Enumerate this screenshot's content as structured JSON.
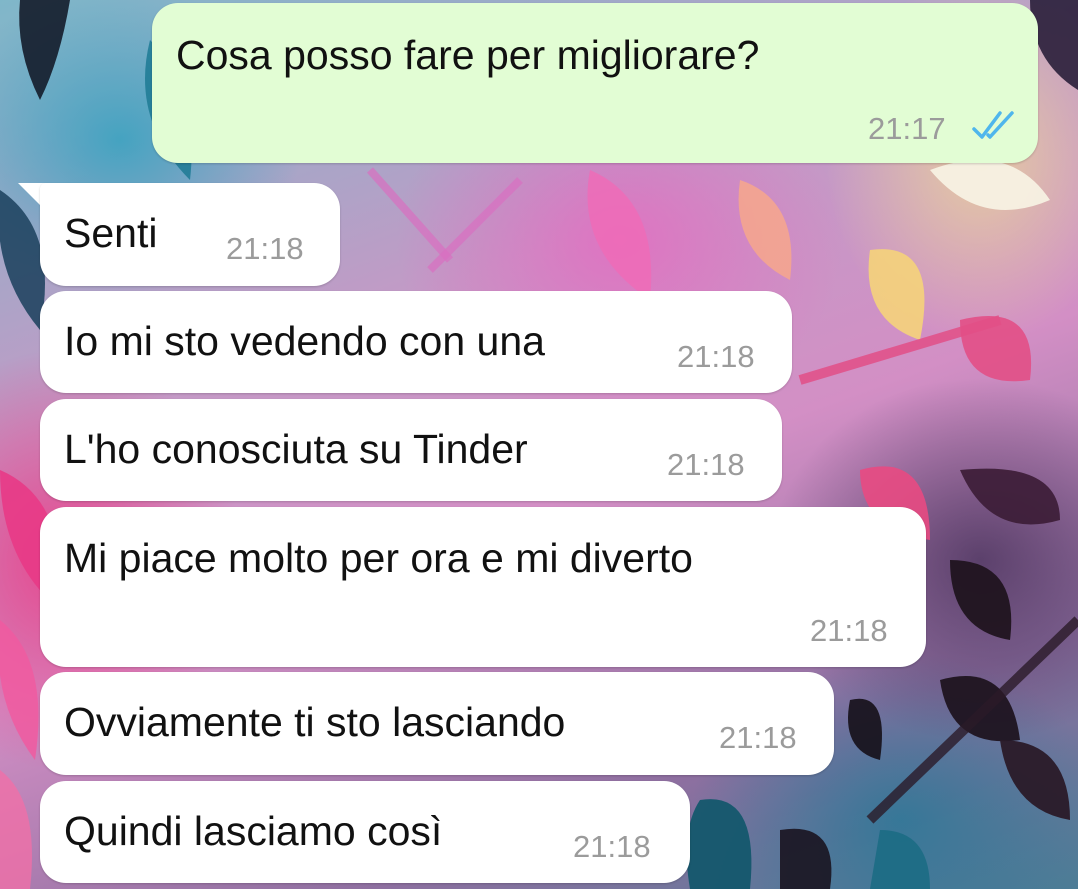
{
  "chat": {
    "messages": [
      {
        "direction": "outgoing",
        "text": "Cosa posso fare per migliorare?",
        "time": "21:17",
        "status": "read",
        "status_icon": "double-check-icon"
      },
      {
        "direction": "incoming",
        "text": "Senti",
        "time": "21:18"
      },
      {
        "direction": "incoming",
        "text": "Io mi sto vedendo con una",
        "time": "21:18"
      },
      {
        "direction": "incoming",
        "text": "L'ho conosciuta su Tinder",
        "time": "21:18"
      },
      {
        "direction": "incoming",
        "text": "Mi piace molto per ora e mi diverto",
        "time": "21:18"
      },
      {
        "direction": "incoming",
        "text": "Ovviamente ti sto lasciando",
        "time": "21:18"
      },
      {
        "direction": "incoming",
        "text": "Quindi lasciamo così",
        "time": "21:18"
      }
    ]
  },
  "colors": {
    "incoming_bubble": "#ffffff",
    "outgoing_bubble": "#e2fdd4",
    "timestamp": "#9b9b9b",
    "read_ticks": "#4fb6ec",
    "text": "#111111"
  }
}
